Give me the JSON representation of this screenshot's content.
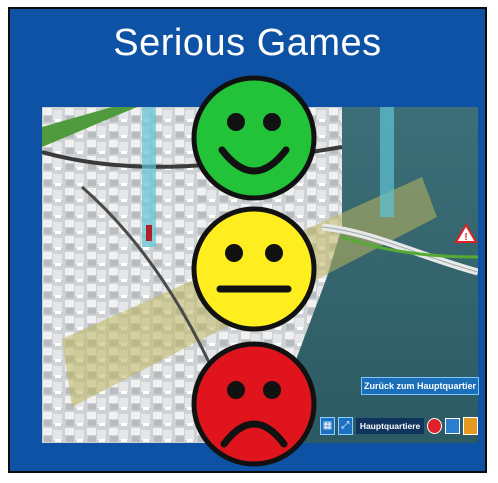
{
  "title": "Serious Games",
  "scene": {
    "description_icon": "city-map-scene"
  },
  "smileys": [
    {
      "mood": "happy",
      "color": "#22c239",
      "icon": "happy-face-icon"
    },
    {
      "mood": "neutral",
      "color": "#ffee1f",
      "icon": "neutral-face-icon"
    },
    {
      "mood": "sad",
      "color": "#e0141c",
      "icon": "sad-face-icon"
    }
  ],
  "hud": {
    "back_button": "Zurück zum Hauptquartier",
    "hq_label": "Hauptquartiere"
  },
  "colors": {
    "background": "#0e52a6",
    "hud_accent": "#1a6fb8"
  }
}
